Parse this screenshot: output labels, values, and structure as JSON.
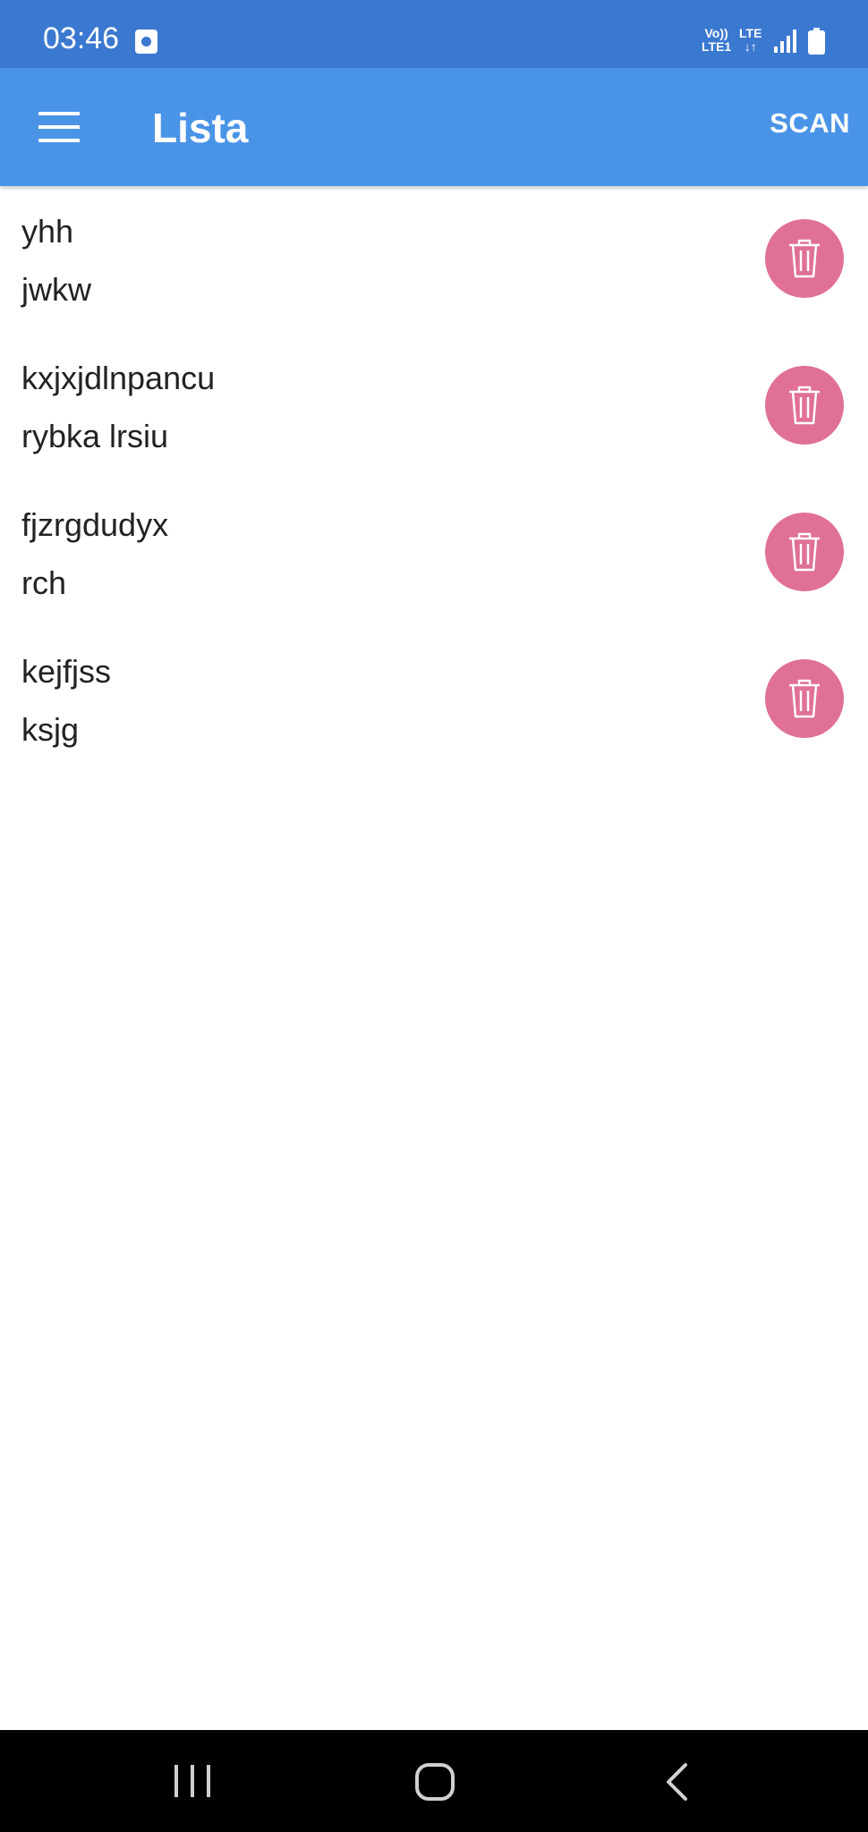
{
  "status_bar": {
    "time": "03:46",
    "volte_line1": "Vo))",
    "volte_line2": "LTE1",
    "lte_line1": "LTE",
    "lte_line2": "↓↑"
  },
  "app_bar": {
    "title": "Lista",
    "scan_label": "SCAN",
    "menu_icon": "hamburger-menu-icon"
  },
  "items": [
    {
      "line1": "yhh",
      "line2": "jwkw"
    },
    {
      "line1": "kxjxjdlnpancu",
      "line2": "rybka lrsiu"
    },
    {
      "line1": "fjzrgdudyx",
      "line2": "rch"
    },
    {
      "line1": "kejfjss",
      "line2": "ksjg"
    }
  ],
  "delete_icon": "trash-icon",
  "colors": {
    "status_bar": "#3b78d0",
    "app_bar": "#4a94e8",
    "delete_button": "#e07096",
    "nav_bar": "#000000"
  }
}
